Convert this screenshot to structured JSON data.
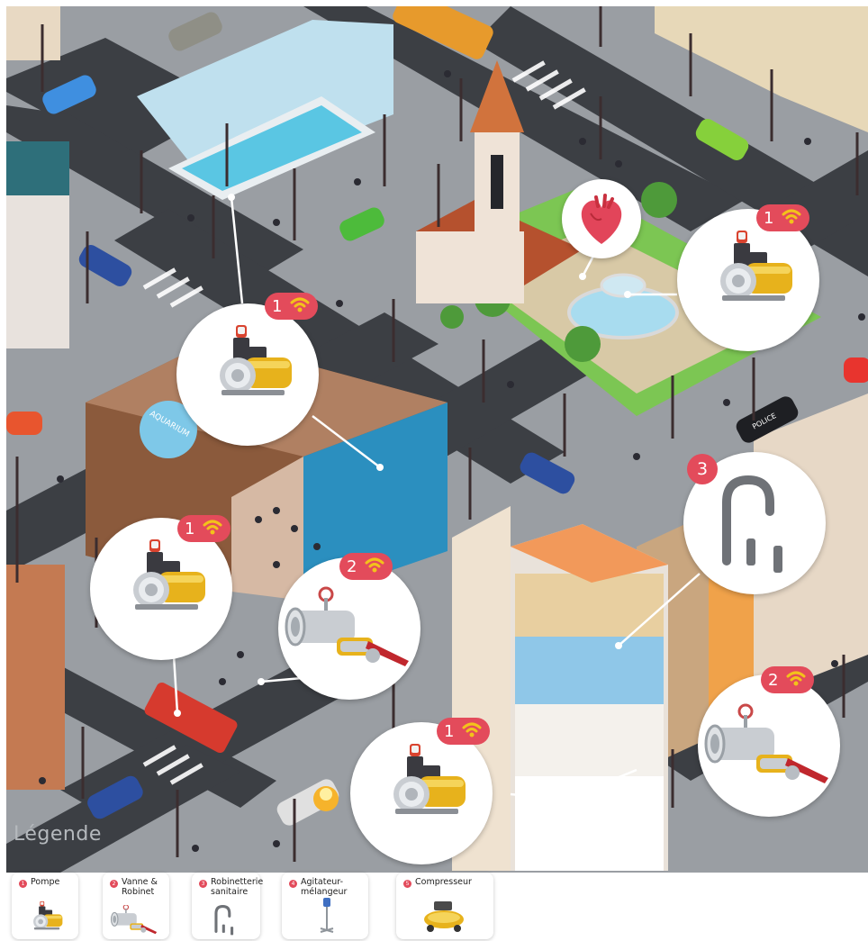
{
  "legend_title": "Légende",
  "aquarium_sign": "AQUARIUM",
  "police_text": "POLICE",
  "legend_items": [
    {
      "num": "1",
      "label": "Pompe",
      "icon": "pump-icon"
    },
    {
      "num": "2",
      "label": "Vanne &\nRobinet",
      "icon": "valve-icon"
    },
    {
      "num": "3",
      "label": "Robinetterie\nsanitaire",
      "icon": "faucet-icon"
    },
    {
      "num": "4",
      "label": "Agitateur-\nmélangeur",
      "icon": "mixer-icon"
    },
    {
      "num": "5",
      "label": "Compresseur",
      "icon": "compressor-icon"
    }
  ],
  "hotspots": [
    {
      "id": "pool",
      "num": "1",
      "icon": "pump-icon"
    },
    {
      "id": "fountain",
      "num": "1",
      "icon": "pump-icon"
    },
    {
      "id": "aquarium-left",
      "num": "1",
      "icon": "pump-icon"
    },
    {
      "id": "fire",
      "num": "2",
      "icon": "valve-icon"
    },
    {
      "id": "bathroom",
      "num": "3",
      "icon": "faucet-icon"
    },
    {
      "id": "basement",
      "num": "1",
      "icon": "pump-icon"
    },
    {
      "id": "street",
      "num": "2",
      "icon": "valve-icon"
    },
    {
      "id": "health",
      "icon": "heart-icon"
    }
  ],
  "colors": {
    "badge": "#e34b5b",
    "road": "#3c3f44",
    "sidewalk": "#9a9ea3",
    "grass": "#7cc653",
    "water": "#a8dcef"
  }
}
